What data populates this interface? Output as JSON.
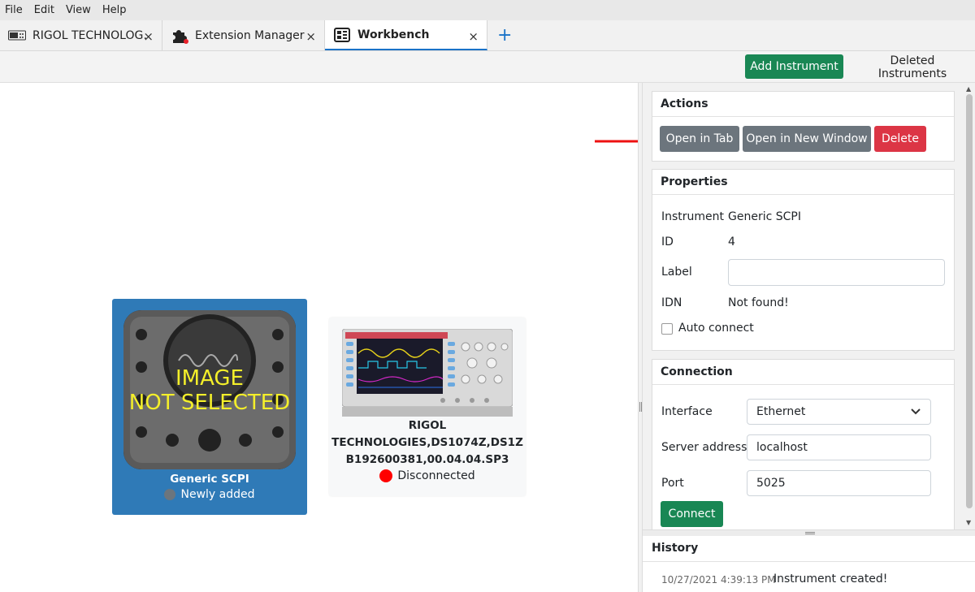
{
  "menu": [
    "File",
    "Edit",
    "View",
    "Help"
  ],
  "tabs": [
    {
      "label": "RIGOL TECHNOLOG…",
      "icon": "oscilloscope-icon",
      "active": false
    },
    {
      "label": "Extension Manager",
      "icon": "puzzle-icon",
      "active": false
    },
    {
      "label": "Workbench",
      "icon": "workbench-icon",
      "active": true
    }
  ],
  "tab_close": "×",
  "tab_add": "+",
  "toolbar": {
    "add_instrument": "Add Instrument",
    "deleted_instruments": "Deleted Instruments"
  },
  "workbench": {
    "generic": {
      "placeholder_line1": "IMAGE",
      "placeholder_line2": "NOT SELECTED",
      "name": "Generic SCPI",
      "status": "Newly added",
      "status_color": "#6c757d",
      "selected_color": "#2f7ab7"
    },
    "rigol": {
      "name_lines": [
        "RIGOL",
        "TECHNOLOGIES,DS1074Z,DS1Z",
        "B192600381,00.04.04.SP3"
      ],
      "status": "Disconnected",
      "status_color": "#ff0000"
    }
  },
  "actions": {
    "title": "Actions",
    "open_tab": "Open in Tab",
    "open_window": "Open in New Window",
    "delete": "Delete"
  },
  "properties": {
    "title": "Properties",
    "instrument_label": "Instrument",
    "instrument_value": "Generic SCPI",
    "id_label": "ID",
    "id_value": "4",
    "label_label": "Label",
    "label_value": "",
    "idn_label": "IDN",
    "idn_value": "Not found!",
    "auto_connect": "Auto connect"
  },
  "connection": {
    "title": "Connection",
    "interface_label": "Interface",
    "interface_value": "Ethernet",
    "server_label": "Server address",
    "server_value": "localhost",
    "port_label": "Port",
    "port_value": "5025",
    "connect": "Connect"
  },
  "history": {
    "title": "History",
    "entries": [
      {
        "time": "10/27/2021 4:39:13 PM",
        "message": "Instrument created!"
      }
    ]
  },
  "colors": {
    "primary": "#1a73c8",
    "success": "#198754",
    "danger": "#dc3545",
    "secondary": "#6c757d",
    "annotation_arrow": "#ee1111"
  }
}
